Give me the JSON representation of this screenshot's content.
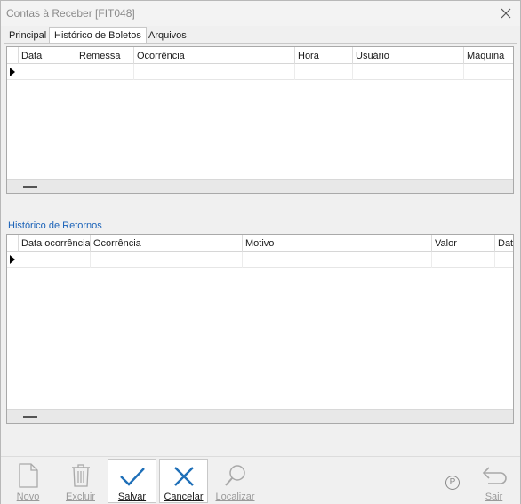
{
  "window": {
    "title": "Contas à Receber [FIT048]"
  },
  "tabs": [
    {
      "label": "Principal",
      "active": false
    },
    {
      "label": "Histórico de Boletos",
      "active": true
    },
    {
      "label": "Arquivos",
      "active": false
    }
  ],
  "boletos_grid": {
    "columns": [
      "Data",
      "Remessa",
      "Ocorrência",
      "Hora",
      "Usuário",
      "Máquina"
    ],
    "rows": [
      [
        "",
        "",
        "",
        "",
        "",
        ""
      ]
    ]
  },
  "retornos_section": {
    "label": "Histórico de Retornos"
  },
  "retornos_grid": {
    "columns": [
      "Data ocorrência",
      "Ocorrência",
      "Motivo",
      "Valor",
      "Dat"
    ],
    "rows": [
      [
        "",
        "",
        "",
        "",
        ""
      ]
    ]
  },
  "toolbar": {
    "novo_label": "Novo",
    "excluir_label": "Excluir",
    "salvar_label": "Salvar",
    "cancelar_label": "Cancelar",
    "localizar_label": "Localizar",
    "sair_label": "Sair",
    "p_label": "P"
  },
  "colors": {
    "accent_blue": "#1a62b8",
    "icon_blue": "#1e6fb8",
    "disabled_gray": "#9a9a9a"
  },
  "icons": {
    "close": "close-icon",
    "novo": "document-icon",
    "excluir": "trash-icon",
    "salvar": "checkmark-icon",
    "cancelar": "x-icon",
    "localizar": "magnifier-icon",
    "sair": "return-arrow-icon",
    "p": "p-circle-icon"
  }
}
